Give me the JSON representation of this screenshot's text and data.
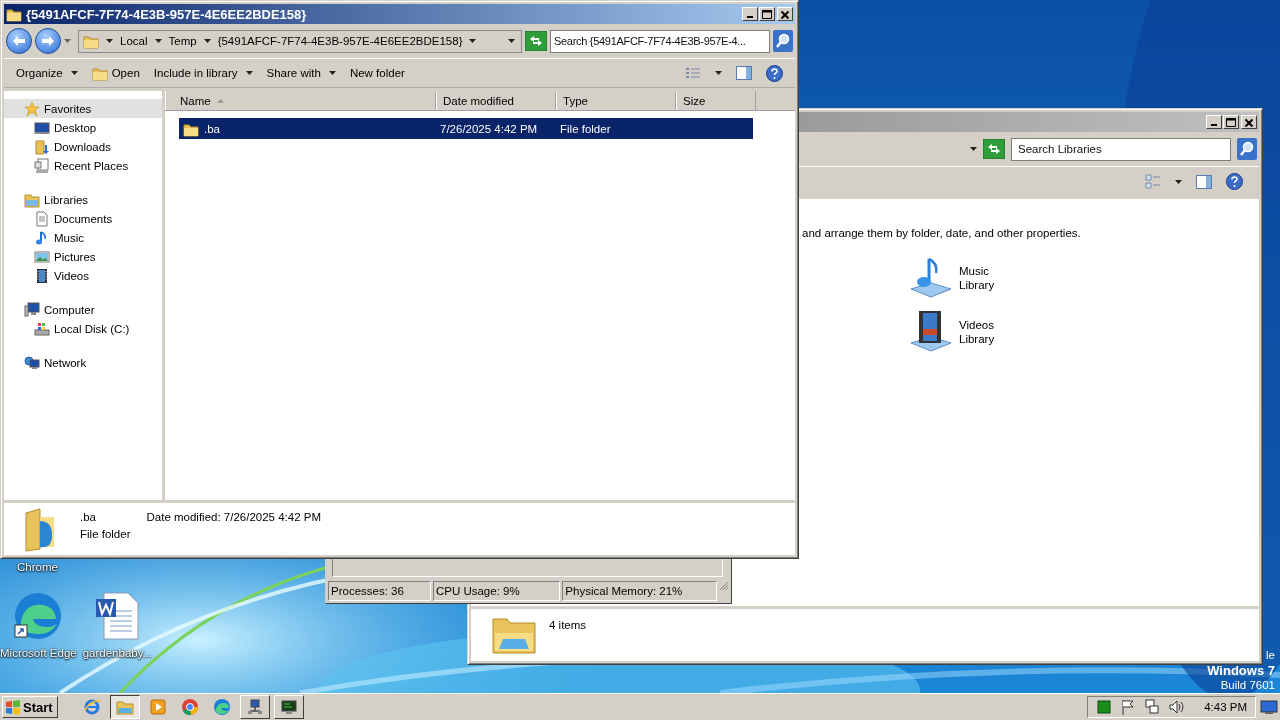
{
  "explorer": {
    "title": "{5491AFCF-7F74-4E3B-957E-4E6EE2BDE158}",
    "breadcrumb": [
      "Local",
      "Temp",
      "{5491AFCF-7F74-4E3B-957E-4E6EE2BDE158}"
    ],
    "search": {
      "placeholder": "Search {5491AFCF-7F74-4E3B-957E-4..."
    },
    "toolbar": [
      {
        "label": "Organize",
        "kind": "menu"
      },
      {
        "label": "Open",
        "kind": "open"
      },
      {
        "label": "Include in library",
        "kind": "menu"
      },
      {
        "label": "Share with",
        "kind": "menu"
      },
      {
        "label": "New folder",
        "kind": "plain"
      }
    ],
    "navigation": [
      {
        "label": "Favorites",
        "kind": "star",
        "selected": true,
        "children": [
          {
            "label": "Desktop",
            "kind": "desktop",
            "selected": false
          },
          {
            "label": "Downloads",
            "kind": "downloads",
            "selected": false
          },
          {
            "label": "Recent Places",
            "kind": "recent",
            "selected": false
          }
        ]
      },
      {
        "label": "Libraries",
        "kind": "libraries",
        "selected": false,
        "children": [
          {
            "label": "Documents",
            "kind": "documents",
            "selected": false
          },
          {
            "label": "Music",
            "kind": "music",
            "selected": false
          },
          {
            "label": "Pictures",
            "kind": "pictures",
            "selected": false
          },
          {
            "label": "Videos",
            "kind": "videos",
            "selected": false
          }
        ]
      },
      {
        "label": "Computer",
        "kind": "computer",
        "selected": false,
        "children": [
          {
            "label": "Local Disk (C:)",
            "kind": "disk",
            "selected": false
          }
        ]
      },
      {
        "label": "Network",
        "kind": "network",
        "selected": false
      }
    ],
    "columns": [
      {
        "label": "Name",
        "sorted": true
      },
      {
        "label": "Date modified",
        "sorted": false
      },
      {
        "label": "Type",
        "sorted": false
      },
      {
        "label": "Size",
        "sorted": false
      }
    ],
    "rows": [
      {
        "name": ".ba",
        "date_modified": "7/26/2025 4:42 PM",
        "type": "File folder",
        "selected": true
      }
    ],
    "details": {
      "name": ".ba",
      "date_label": "Date modified:",
      "date_value": "7/26/2025 4:42 PM",
      "type": "File folder"
    }
  },
  "libraries_window": {
    "search": {
      "placeholder": "Search Libraries"
    },
    "description": "and arrange them by folder, date, and other properties.",
    "libraries": [
      {
        "label": "Music Library",
        "kind": "music"
      },
      {
        "label": "Videos Library",
        "kind": "videos"
      }
    ],
    "status": "4 items"
  },
  "task_manager": {
    "status": [
      "Processes: 36",
      "CPU Usage: 9%",
      "Physical Memory: 21%"
    ]
  },
  "desktop": {
    "icons": [
      {
        "label": "Chrome",
        "kind": "covered"
      },
      {
        "label": "Microsoft Edge",
        "kind": "edge"
      },
      {
        "label": "gardenbaby...",
        "kind": "word"
      }
    ],
    "os_text": [
      "le",
      "Windows 7",
      "Build 7601"
    ]
  },
  "taskbar": {
    "start": "Start",
    "apps": [
      {
        "kind": "ie",
        "selected": false,
        "running": false
      },
      {
        "kind": "explorer",
        "selected": true,
        "running": true
      },
      {
        "kind": "media",
        "selected": false,
        "running": false
      },
      {
        "kind": "chrome",
        "selected": false,
        "running": false
      },
      {
        "kind": "edge",
        "selected": false,
        "running": false
      },
      {
        "kind": "network",
        "selected": false,
        "running": true
      },
      {
        "kind": "monitor",
        "selected": false,
        "running": true
      }
    ],
    "tray": [
      {
        "kind": "status"
      },
      {
        "kind": "flag"
      },
      {
        "kind": "network"
      },
      {
        "kind": "volume"
      }
    ],
    "clock": "4:43 PM"
  }
}
